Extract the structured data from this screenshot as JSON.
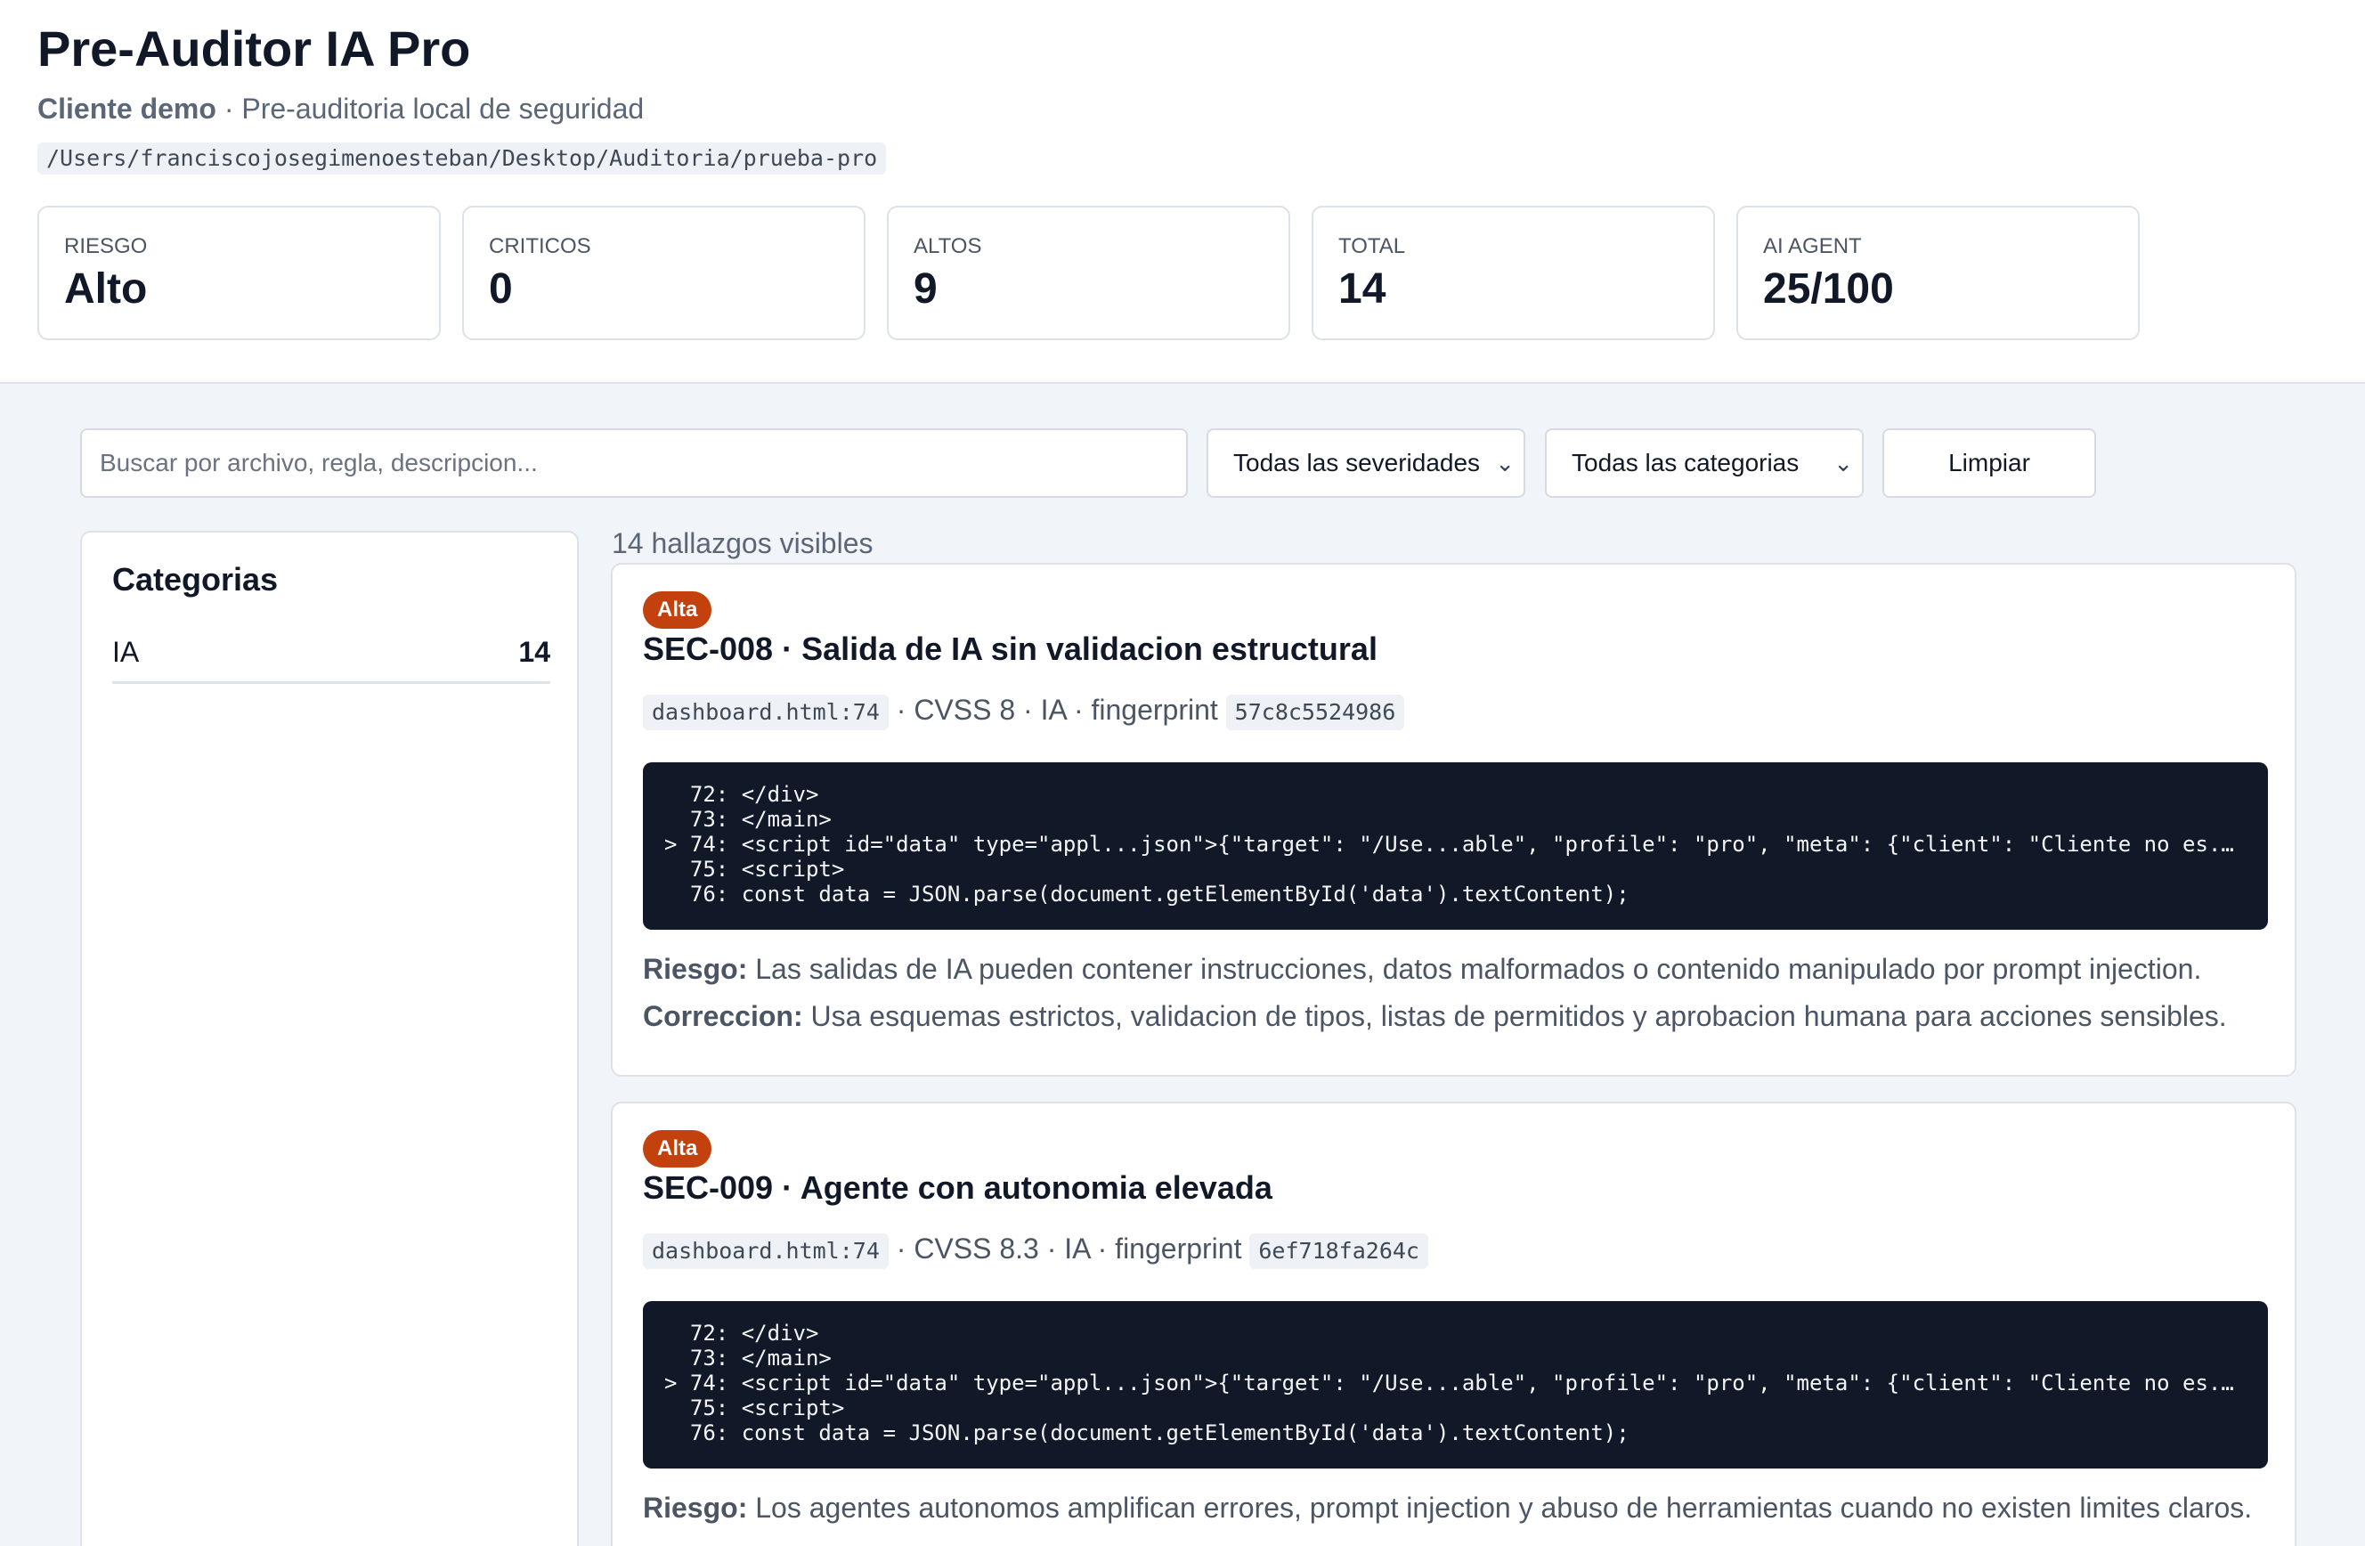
{
  "header": {
    "title": "Pre-Auditor IA Pro",
    "client": "Cliente demo",
    "subtitle_rest": " · Pre-auditoria local de seguridad",
    "path": "/Users/franciscojosegimenoesteban/Desktop/Auditoria/prueba-pro"
  },
  "stats": [
    {
      "label": "RIESGO",
      "value": "Alto"
    },
    {
      "label": "CRITICOS",
      "value": "0"
    },
    {
      "label": "ALTOS",
      "value": "9"
    },
    {
      "label": "TOTAL",
      "value": "14"
    },
    {
      "label": "AI AGENT",
      "value": "25/100"
    }
  ],
  "toolbar": {
    "search_placeholder": "Buscar por archivo, regla, descripcion...",
    "severity_select": "Todas las severidades",
    "category_select": "Todas las categorias",
    "clear_label": "Limpiar"
  },
  "sidebar": {
    "title": "Categorias",
    "items": [
      {
        "name": "IA",
        "count": "14"
      }
    ]
  },
  "findings_count": "14 hallazgos visibles",
  "findings": [
    {
      "severity": "Alta",
      "title": "SEC-008 · Salida de IA sin validacion estructural",
      "file": "dashboard.html:74",
      "meta_mid": " · CVSS 8 · IA · fingerprint ",
      "fingerprint": "57c8c5524986",
      "code": [
        "  72: </div>",
        "  73: </main>",
        "> 74: <script id=\"data\" type=\"appl...json\">{\"target\": \"/Use...able\", \"profile\": \"pro\", \"meta\": {\"client\": \"Cliente no es...",
        "  75: <script>",
        "  76: const data = JSON.parse(document.getElementById('data').textContent);"
      ],
      "risk_label": "Riesgo:",
      "risk": " Las salidas de IA pueden contener instrucciones, datos malformados o contenido manipulado por prompt injection.",
      "fix_label": "Correccion:",
      "fix": " Usa esquemas estrictos, validacion de tipos, listas de permitidos y aprobacion humana para acciones sensibles."
    },
    {
      "severity": "Alta",
      "title": "SEC-009 · Agente con autonomia elevada",
      "file": "dashboard.html:74",
      "meta_mid": " · CVSS 8.3 · IA · fingerprint ",
      "fingerprint": "6ef718fa264c",
      "code": [
        "  72: </div>",
        "  73: </main>",
        "> 74: <script id=\"data\" type=\"appl...json\">{\"target\": \"/Use...able\", \"profile\": \"pro\", \"meta\": {\"client\": \"Cliente no es...",
        "  75: <script>",
        "  76: const data = JSON.parse(document.getElementById('data').textContent);"
      ],
      "risk_label": "Riesgo:",
      "risk": " Los agentes autonomos amplifican errores, prompt injection y abuso de herramientas cuando no existen limites claros."
    }
  ]
}
